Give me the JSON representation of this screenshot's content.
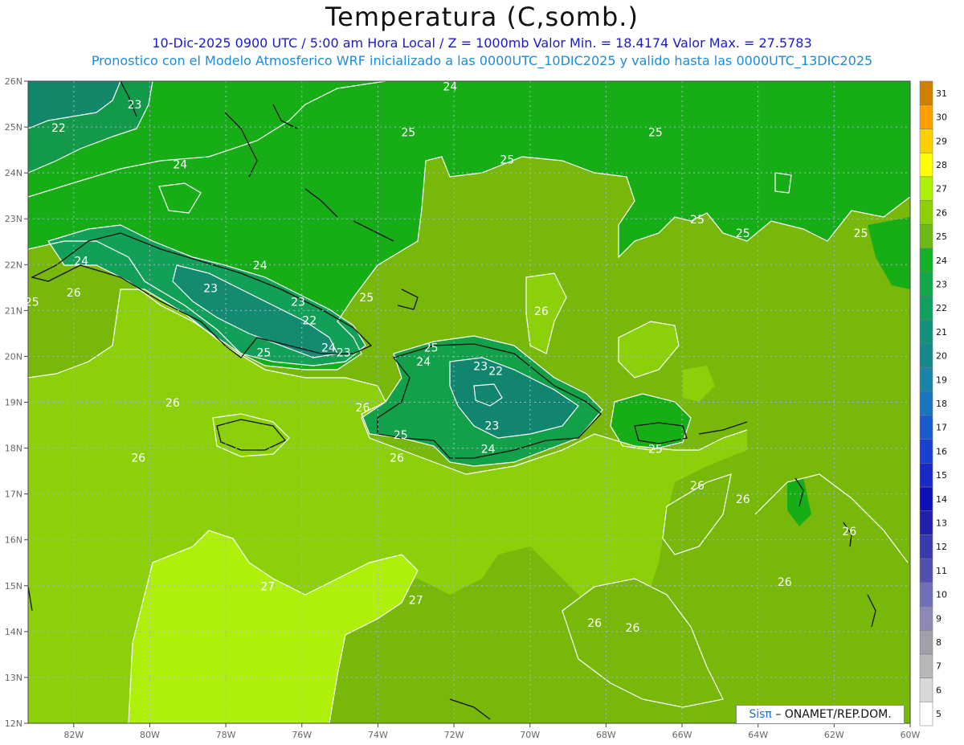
{
  "header": {
    "title": "Temperatura (C,somb.)",
    "subtitle_line1": "10-Dic-2025  0900 UTC / 5:00 am Hora Local / Z = 1000mb    Valor Min. = 18.4174  Valor Max. = 27.5783",
    "subtitle_line2": "Pronostico con el Modelo Atmosferico WRF inicializado a las 0000UTC_10DIC2025 y valido hasta las  0000UTC_13DIC2025"
  },
  "axes": {
    "lon_ticks": [
      "82W",
      "80W",
      "78W",
      "76W",
      "74W",
      "72W",
      "70W",
      "68W",
      "66W",
      "64W",
      "62W",
      "60W"
    ],
    "lat_ticks": [
      "12N",
      "13N",
      "14N",
      "15N",
      "16N",
      "17N",
      "18N",
      "19N",
      "20N",
      "21N",
      "22N",
      "23N",
      "24N",
      "25N",
      "26N"
    ],
    "lon_range": [
      -83.2,
      -60
    ],
    "lat_range": [
      12,
      26
    ]
  },
  "colorbar": {
    "levels": [
      5,
      6,
      7,
      8,
      9,
      10,
      11,
      12,
      13,
      14,
      15,
      16,
      17,
      18,
      19,
      20,
      21,
      22,
      23,
      24,
      25,
      26,
      27,
      28,
      29,
      30,
      31
    ],
    "colors": [
      "#ffffff",
      "#d8d8d8",
      "#b8b8b8",
      "#a0a0a8",
      "#8c88b8",
      "#7070b8",
      "#5050b0",
      "#3a3ab0",
      "#2020a8",
      "#1010b8",
      "#1a28c8",
      "#1a40d0",
      "#1a5cd0",
      "#1a74c0",
      "#1a84a8",
      "#168a8a",
      "#12927a",
      "#12a060",
      "#12a848",
      "#14b028",
      "#6cb814",
      "#8cd00a",
      "#aef00a",
      "#ffff00",
      "#ffd000",
      "#ffa000",
      "#d08000"
    ]
  },
  "contour_labels": [
    {
      "text": "23",
      "lon": -80.4,
      "lat": 25.4
    },
    {
      "text": "22",
      "lon": -82.4,
      "lat": 24.9
    },
    {
      "text": "24",
      "lon": -79.2,
      "lat": 24.1
    },
    {
      "text": "24",
      "lon": -72.1,
      "lat": 25.8
    },
    {
      "text": "25",
      "lon": -73.2,
      "lat": 24.8
    },
    {
      "text": "25",
      "lon": -70.6,
      "lat": 24.2
    },
    {
      "text": "25",
      "lon": -66.7,
      "lat": 24.8
    },
    {
      "text": "25",
      "lon": -65.6,
      "lat": 22.9
    },
    {
      "text": "25",
      "lon": -64.4,
      "lat": 22.6
    },
    {
      "text": "25",
      "lon": -61.3,
      "lat": 22.6
    },
    {
      "text": "24",
      "lon": -81.8,
      "lat": 22.0
    },
    {
      "text": "23",
      "lon": -78.4,
      "lat": 21.4
    },
    {
      "text": "24",
      "lon": -77.1,
      "lat": 21.9
    },
    {
      "text": "23",
      "lon": -76.1,
      "lat": 21.1
    },
    {
      "text": "22",
      "lon": -75.8,
      "lat": 20.7
    },
    {
      "text": "25",
      "lon": -74.3,
      "lat": 21.2
    },
    {
      "text": "26",
      "lon": -82.0,
      "lat": 21.3
    },
    {
      "text": "25",
      "lon": -83.1,
      "lat": 21.1
    },
    {
      "text": "25",
      "lon": -77.0,
      "lat": 20.0
    },
    {
      "text": "24",
      "lon": -75.3,
      "lat": 20.1
    },
    {
      "text": "23",
      "lon": -74.9,
      "lat": 20.0
    },
    {
      "text": "25",
      "lon": -72.6,
      "lat": 20.1
    },
    {
      "text": "24",
      "lon": -72.8,
      "lat": 19.8
    },
    {
      "text": "23",
      "lon": -71.3,
      "lat": 19.7
    },
    {
      "text": "22",
      "lon": -70.9,
      "lat": 19.6
    },
    {
      "text": "26",
      "lon": -69.7,
      "lat": 20.9
    },
    {
      "text": "26",
      "lon": -79.4,
      "lat": 18.9
    },
    {
      "text": "26",
      "lon": -74.4,
      "lat": 18.8
    },
    {
      "text": "25",
      "lon": -73.4,
      "lat": 18.2
    },
    {
      "text": "26",
      "lon": -73.5,
      "lat": 17.7
    },
    {
      "text": "23",
      "lon": -71.0,
      "lat": 18.4
    },
    {
      "text": "24",
      "lon": -71.1,
      "lat": 17.9
    },
    {
      "text": "25",
      "lon": -66.7,
      "lat": 17.9
    },
    {
      "text": "26",
      "lon": -80.3,
      "lat": 17.7
    },
    {
      "text": "26",
      "lon": -65.6,
      "lat": 17.1
    },
    {
      "text": "26",
      "lon": -64.4,
      "lat": 16.8
    },
    {
      "text": "26",
      "lon": -61.6,
      "lat": 16.1
    },
    {
      "text": "26",
      "lon": -63.3,
      "lat": 15.0
    },
    {
      "text": "27",
      "lon": -76.9,
      "lat": 14.9
    },
    {
      "text": "27",
      "lon": -73.0,
      "lat": 14.6
    },
    {
      "text": "26",
      "lon": -68.3,
      "lat": 14.1
    },
    {
      "text": "26",
      "lon": -67.3,
      "lat": 14.0
    }
  ],
  "footer": {
    "watermark_sis": "Sisπ",
    "watermark_rest": "– ONAMET/REP.DOM."
  }
}
